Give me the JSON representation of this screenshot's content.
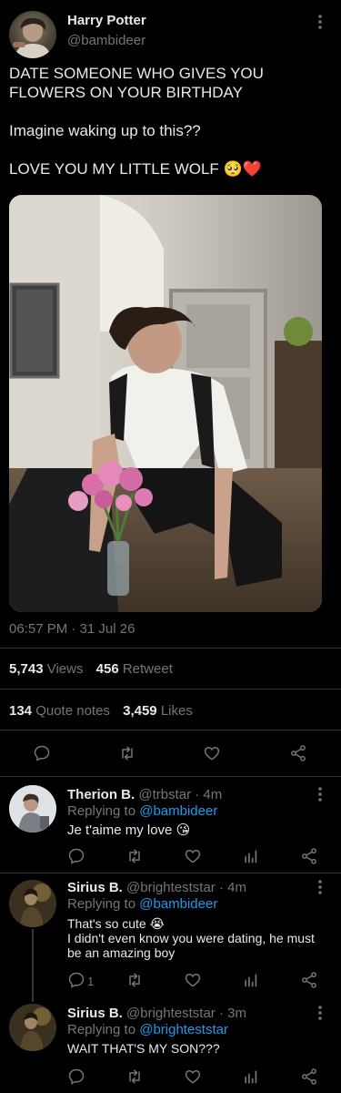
{
  "tweet": {
    "author_name": "Harry Potter",
    "handle": "@bambideer",
    "line1": "DATE SOMEONE WHO GIVES YOU",
    "line2": "FLOWERS ON YOUR BIRTHDAY",
    "line3": "Imagine waking up to this??",
    "line4": "LOVE YOU MY LITTLE WOLF 🥺❤️",
    "timestamp": "06:57 PM · 31 Jul 26",
    "stats": {
      "views_count": "5,743",
      "views_label": "Views",
      "retweets_count": "456",
      "retweets_label": "Retweet",
      "quotes_count": "134",
      "quotes_label": "Quote notes",
      "likes_count": "3,459",
      "likes_label": "Likes"
    }
  },
  "replies": [
    {
      "name": "Therion B.",
      "meta": "@trbstar · 4m",
      "replying_label": "Replying to",
      "replying_to": "@bambideer",
      "text": [
        "Je t'aime my love 😘"
      ],
      "reply_count": ""
    },
    {
      "name": "Sirius B.",
      "meta": "@brighteststar · 4m",
      "replying_label": "Replying to",
      "replying_to": "@bambideer",
      "text": [
        "That's so cute 😭",
        "I didn't even know you were dating, he must",
        "be an amazing boy"
      ],
      "reply_count": "1"
    },
    {
      "name": "Sirius B.",
      "meta": "@brighteststar · 3m",
      "replying_label": "Replying to",
      "replying_to": "@brighteststar",
      "text": [
        "WAIT THAT'S MY SON???"
      ],
      "reply_count": ""
    }
  ],
  "icons": [
    "more-vertical-icon",
    "reply-icon",
    "retweet-icon",
    "like-icon",
    "share-icon",
    "analytics-icon"
  ],
  "colors": {
    "background": "#000000",
    "text": "#e7e9ea",
    "muted": "#71767b",
    "link": "#1d9bf0",
    "divider": "#2f3336"
  }
}
